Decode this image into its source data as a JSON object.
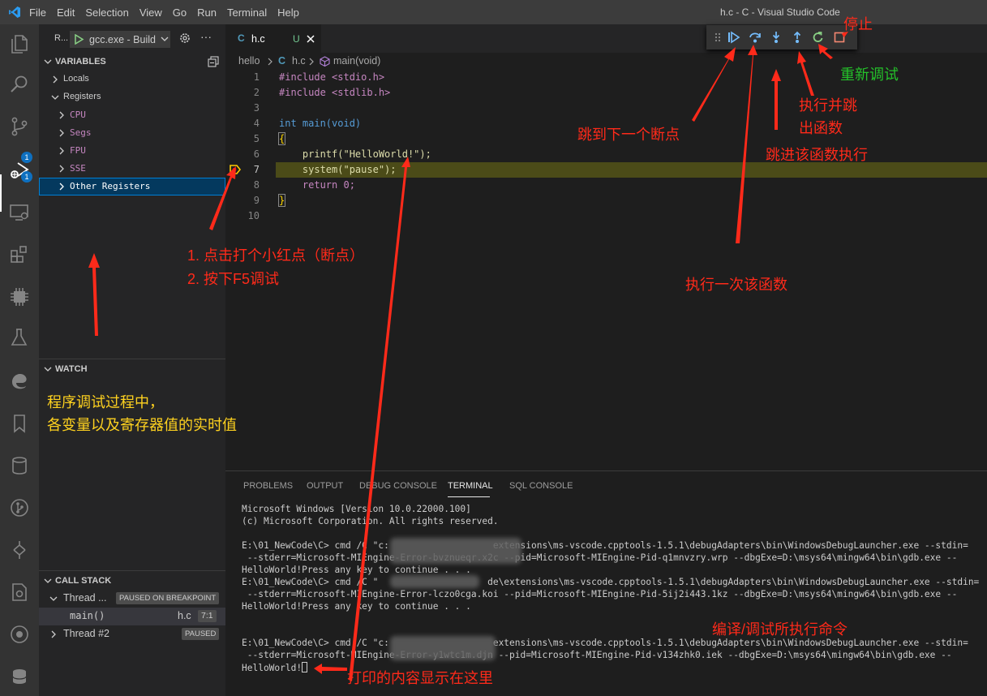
{
  "titlebar": {
    "menu": [
      "File",
      "Edit",
      "Selection",
      "View",
      "Go",
      "Run",
      "Terminal",
      "Help"
    ],
    "window_title": "h.c - C - Visual Studio Code"
  },
  "activity": {
    "badge_scm": "1",
    "badge_debug": "1"
  },
  "debug_toolbar": {
    "run_label": "R...",
    "config": "gcc.exe - Build"
  },
  "variables": {
    "title": "VARIABLES",
    "locals": "Locals",
    "registers": "Registers",
    "register_groups": [
      "CPU",
      "Segs",
      "FPU",
      "SSE",
      "Other Registers"
    ]
  },
  "watch": {
    "title": "WATCH"
  },
  "callstack": {
    "title": "CALL STACK",
    "thread1": "Thread ...",
    "thread1_status": "PAUSED ON BREAKPOINT",
    "frame_func": "main()",
    "frame_file": "h.c",
    "frame_pos": "7:1",
    "thread2": "Thread #2",
    "thread2_status": "PAUSED"
  },
  "editor": {
    "tab_icon": "C",
    "tab_name": "h.c",
    "tab_status": "U",
    "breadcrumb": [
      "hello",
      "h.c",
      "main(void)"
    ],
    "breadcrumb_c": "C",
    "lines": [
      "#include <stdio.h>",
      "#include <stdlib.h>",
      "",
      "int main(void)",
      "{",
      "    printf(\"HelloWorld!\");",
      "    system(\"pause\");",
      "    return 0;",
      "}",
      ""
    ],
    "line_numbers": [
      "1",
      "2",
      "3",
      "4",
      "5",
      "6",
      "7",
      "8",
      "9",
      "10"
    ],
    "current_line": 7
  },
  "panel": {
    "tabs": [
      "PROBLEMS",
      "OUTPUT",
      "DEBUG CONSOLE",
      "TERMINAL",
      "SQL CONSOLE"
    ],
    "active_tab": "TERMINAL",
    "terminal_lines": [
      "Microsoft Windows [Version 10.0.22000.100]",
      "(c) Microsoft Corporation. All rights reserved.",
      "",
      "E:\\01_NewCode\\C> cmd /C \"c:                   extensions\\ms-vscode.cpptools-1.5.1\\debugAdapters\\bin\\WindowsDebugLauncher.exe --stdin=",
      " --stderr=Microsoft-MIEngine-Error-bvznueqr.x2c --pid=Microsoft-MIEngine-Pid-q1mnvzry.wrp --dbgExe=D:\\msys64\\mingw64\\bin\\gdb.exe --",
      "HelloWorld!Press any key to continue . . .",
      "E:\\01_NewCode\\C> cmd /C \"                    de\\extensions\\ms-vscode.cpptools-1.5.1\\debugAdapters\\bin\\WindowsDebugLauncher.exe --stdin=",
      " --stderr=Microsoft-MIEngine-Error-lczo0cga.koi --pid=Microsoft-MIEngine-Pid-5ij2i443.1kz --dbgExe=D:\\msys64\\mingw64\\bin\\gdb.exe --",
      "HelloWorld!Press any key to continue . . .",
      "",
      "",
      "E:\\01_NewCode\\C> cmd /C \"c:                   extensions\\ms-vscode.cpptools-1.5.1\\debugAdapters\\bin\\WindowsDebugLauncher.exe --stdin=",
      " --stderr=Microsoft-MIEngine-Error-y1wtc1m.djn --pid=Microsoft-MIEngine-Pid-v134zhk0.iek --dbgExe=D:\\msys64\\mingw64\\bin\\gdb.exe --",
      "HelloWorld!"
    ]
  },
  "annotations": {
    "stop": "停止",
    "restart": "重新调试",
    "step_out": "执行并跳\n出函数",
    "step_out_1": "执行并跳",
    "step_out_2": "出函数",
    "continue": "跳到下一个断点",
    "step_into": "跳进该函数执行",
    "step_over": "执行一次该函数",
    "breakpoint_1": "1. 点击打个小红点（断点）",
    "breakpoint_2": "2. 按下F5调试",
    "vars_1": "程序调试过程中，",
    "vars_2": "各变量以及寄存器值的实时值",
    "commands": "编译/调试所执行命令",
    "output": "打印的内容显示在这里"
  },
  "colors": {
    "red": "#ff2a1a",
    "yellow": "#ffd21f",
    "green": "#24c22a",
    "accent": "#0e70c0"
  }
}
